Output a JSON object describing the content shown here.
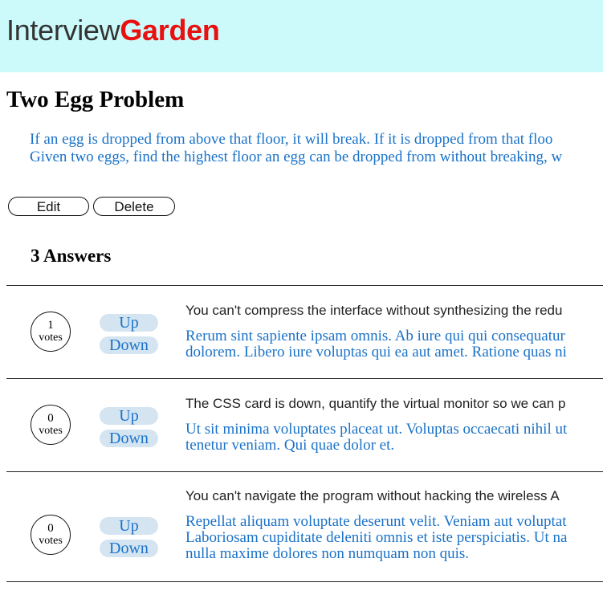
{
  "header": {
    "logo_part1": "Interview",
    "logo_part2": "Garden",
    "colors": {
      "background": "#ccfafa",
      "logo_dark": "#333333",
      "logo_red": "#e81010"
    }
  },
  "question": {
    "title": "Two Egg Problem",
    "description_lines": [
      "If an egg is dropped from above that floor, it will break. If it is dropped from that floo",
      "Given two eggs, find the highest floor an egg can be dropped from without breaking, w"
    ],
    "edit_label": "Edit",
    "delete_label": "Delete"
  },
  "answers_heading": "3 Answers",
  "answers": [
    {
      "votes": "1",
      "votes_label": "votes",
      "up_label": "Up",
      "down_label": "Down",
      "summary": "You can't compress the interface without synthesizing the redu",
      "body_lines": [
        "Rerum sint sapiente ipsam omnis. Ab iure qui qui consequatur",
        "dolorem. Libero iure voluptas qui ea aut amet. Ratione quas ni"
      ]
    },
    {
      "votes": "0",
      "votes_label": "votes",
      "up_label": "Up",
      "down_label": "Down",
      "summary": "The CSS card is down, quantify the virtual monitor so we can p",
      "body_lines": [
        "Ut sit minima voluptates placeat ut. Voluptas occaecati nihil ut",
        "tenetur veniam. Qui quae dolor et."
      ]
    },
    {
      "votes": "0",
      "votes_label": "votes",
      "up_label": "Up",
      "down_label": "Down",
      "summary": "You can't navigate the program without hacking the wireless A",
      "body_lines": [
        "Repellat aliquam voluptate deserunt velit. Veniam aut voluptat",
        "Laboriosam cupiditate deleniti omnis et iste perspiciatis. Ut na",
        "nulla maxime dolores non numquam non quis."
      ]
    }
  ],
  "colors": {
    "link_blue": "#1a72c8",
    "vote_button_bg": "#d4e4f1"
  }
}
